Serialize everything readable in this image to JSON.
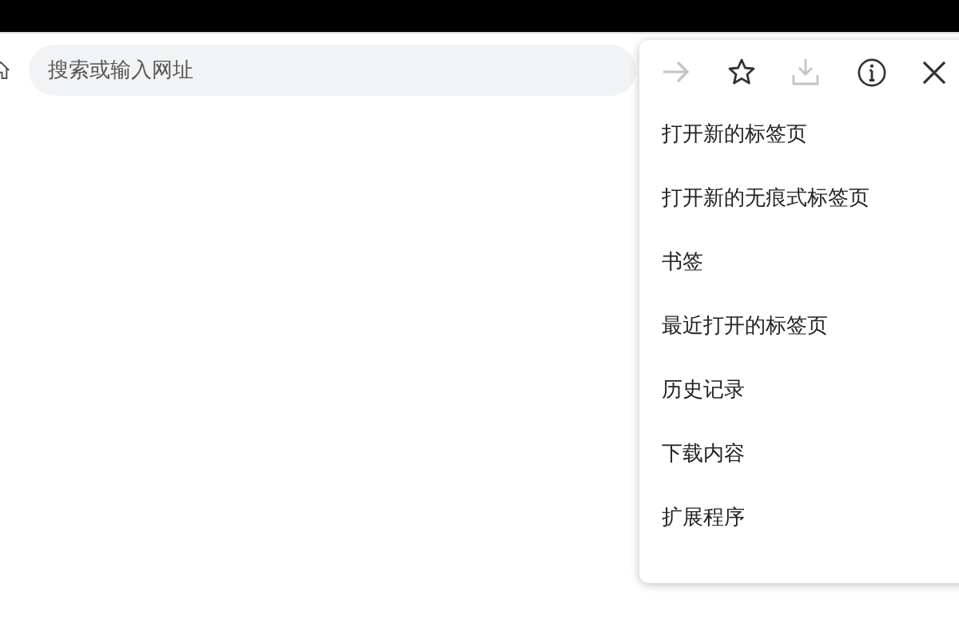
{
  "address_bar": {
    "placeholder": "搜索或输入网址"
  },
  "menu": {
    "toolbar": [
      {
        "kind": "forward",
        "disabled": true
      },
      {
        "kind": "star",
        "disabled": false
      },
      {
        "kind": "download",
        "disabled": true
      },
      {
        "kind": "info",
        "disabled": false
      },
      {
        "kind": "close",
        "disabled": false
      }
    ],
    "items": [
      "打开新的标签页",
      "打开新的无痕式标签页",
      "书签",
      "最近打开的标签页",
      "历史记录",
      "下载内容",
      "扩展程序"
    ]
  }
}
